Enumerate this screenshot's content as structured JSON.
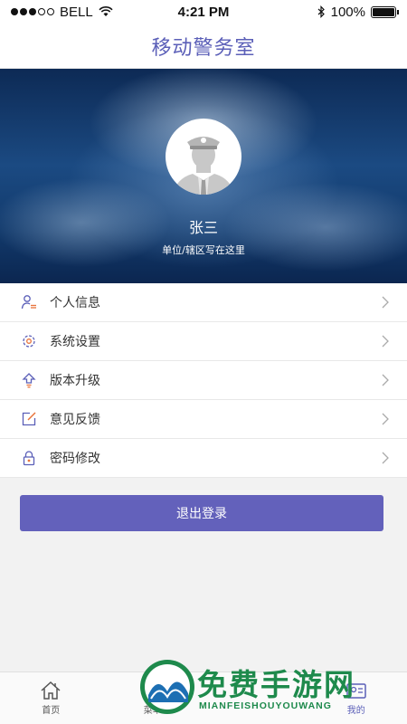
{
  "status_bar": {
    "carrier": "BELL",
    "time": "4:21 PM",
    "battery": "100%"
  },
  "header": {
    "title": "移动警务室"
  },
  "profile": {
    "name": "张三",
    "unit": "单位/辖区写在这里"
  },
  "menu": {
    "items": [
      {
        "label": "个人信息",
        "icon": "user-info-icon"
      },
      {
        "label": "系统设置",
        "icon": "gear-icon"
      },
      {
        "label": "版本升级",
        "icon": "upgrade-arrow-icon"
      },
      {
        "label": "意见反馈",
        "icon": "edit-icon"
      },
      {
        "label": "密码修改",
        "icon": "lock-icon"
      }
    ]
  },
  "logout_label": "退出登录",
  "tabs": [
    {
      "label": "首页",
      "icon": "home-icon"
    },
    {
      "label": "菜单",
      "icon": "grid-icon"
    },
    {
      "label": "",
      "icon": "blank"
    },
    {
      "label": "我的",
      "icon": "profile-icon"
    }
  ],
  "watermark": {
    "text": "免费手游网",
    "subtext": "MIANFEISHOUYOUWANG"
  },
  "colors": {
    "accent": "#5b5fb8",
    "button": "#6361bb",
    "icon_orange": "#e8733a",
    "watermark": "#1e8a4c"
  }
}
